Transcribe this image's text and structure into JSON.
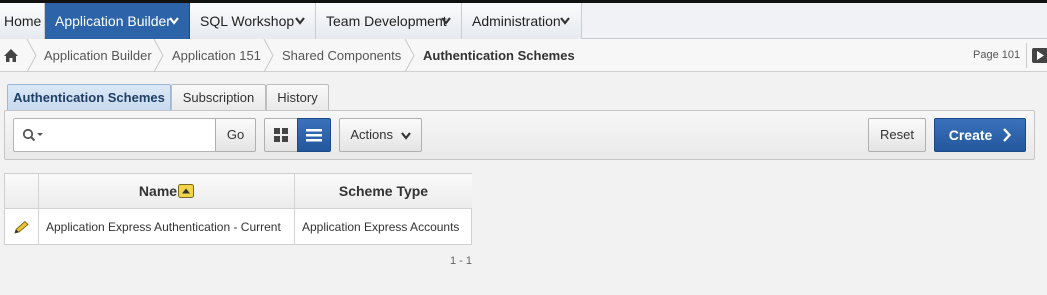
{
  "topnav": {
    "items": [
      {
        "label": "Home"
      },
      {
        "label": "Application Builder"
      },
      {
        "label": "SQL Workshop"
      },
      {
        "label": "Team Development"
      },
      {
        "label": "Administration"
      }
    ]
  },
  "breadcrumb": {
    "items": [
      "Application Builder",
      "Application 151",
      "Shared Components"
    ],
    "current": "Authentication Schemes",
    "page_label": "Page 101"
  },
  "tabs": [
    {
      "label": "Authentication Schemes"
    },
    {
      "label": "Subscription"
    },
    {
      "label": "History"
    }
  ],
  "toolbar": {
    "search_value": "",
    "go_label": "Go",
    "actions_label": "Actions",
    "reset_label": "Reset",
    "create_label": "Create"
  },
  "report": {
    "columns": [
      "Name",
      "Scheme Type"
    ],
    "rows": [
      {
        "name": "Application Express Authentication - Current",
        "scheme_type": "Application Express Accounts"
      }
    ],
    "pagination": "1 - 1"
  },
  "colors": {
    "primary": "#2d64a9",
    "sort_badge": "#f2d44b"
  },
  "icons": [
    "home-icon",
    "search-icon",
    "grid-view-icon",
    "list-view-icon",
    "edit-pencil-icon",
    "chevron-down-icon",
    "chevron-right-icon",
    "sort-ascending-icon"
  ]
}
